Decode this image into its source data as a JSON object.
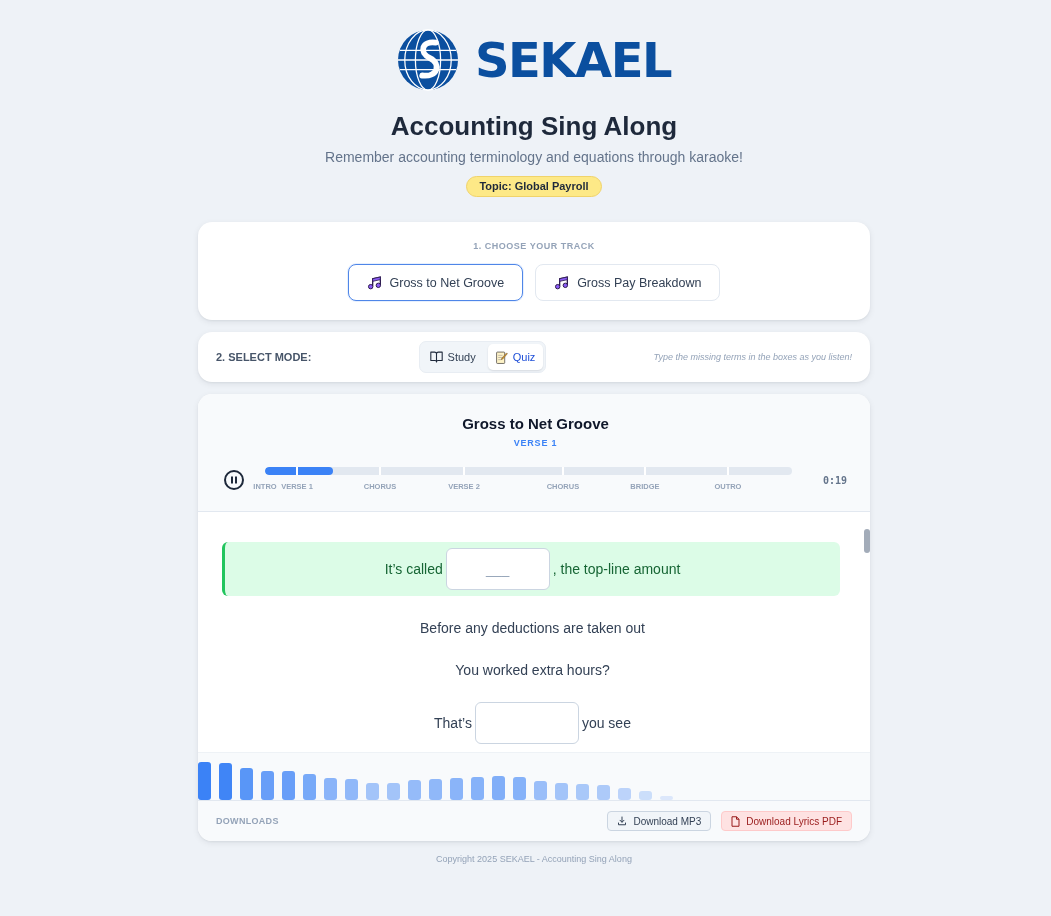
{
  "logo": {
    "wordmark": "SEKAEL"
  },
  "header": {
    "title": "Accounting Sing Along",
    "subtitle": "Remember accounting terminology and equations through karaoke!",
    "topic_badge": "Topic: Global Payroll"
  },
  "track_picker": {
    "heading": "1. CHOOSE YOUR TRACK",
    "tracks": [
      {
        "label": "Gross to Net Groove",
        "selected": true
      },
      {
        "label": "Gross Pay Breakdown",
        "selected": false
      }
    ]
  },
  "mode_picker": {
    "heading": "2. SELECT MODE:",
    "modes": [
      {
        "kind": "study",
        "label": "Study",
        "selected": false
      },
      {
        "kind": "quiz",
        "label": "Quiz",
        "selected": true
      }
    ],
    "hint": "Type the missing terms in the boxes as you listen!"
  },
  "player": {
    "title": "Gross to Net Groove",
    "section": "VERSE 1",
    "playing": true,
    "progress_bar": {
      "level": 0.13
    },
    "sections": [
      "INTRO",
      "VERSE 1",
      "CHORUS",
      "VERSE 2",
      "CHORUS",
      "BRIDGE",
      "OUTRO"
    ],
    "time": "0:19"
  },
  "lyrics": [
    {
      "kind": "blank",
      "active": true,
      "before": "It’s called",
      "placeholder": "___",
      "after": ", the top-line amount"
    },
    {
      "kind": "plain",
      "active": false,
      "text": "Before any deductions are taken out"
    },
    {
      "kind": "plain",
      "active": false,
      "text": "You worked extra hours?"
    },
    {
      "kind": "blank",
      "active": false,
      "before": "That’s",
      "after": "you see"
    }
  ],
  "downloads": {
    "heading": "DOWNLOADS",
    "buttons": [
      {
        "kind": "mp3",
        "label": "Download MP3"
      },
      {
        "kind": "pdf",
        "label": "Download Lyrics PDF"
      }
    ]
  },
  "footer": "Copyright 2025 SEKAEL - Accounting Sing Along"
}
